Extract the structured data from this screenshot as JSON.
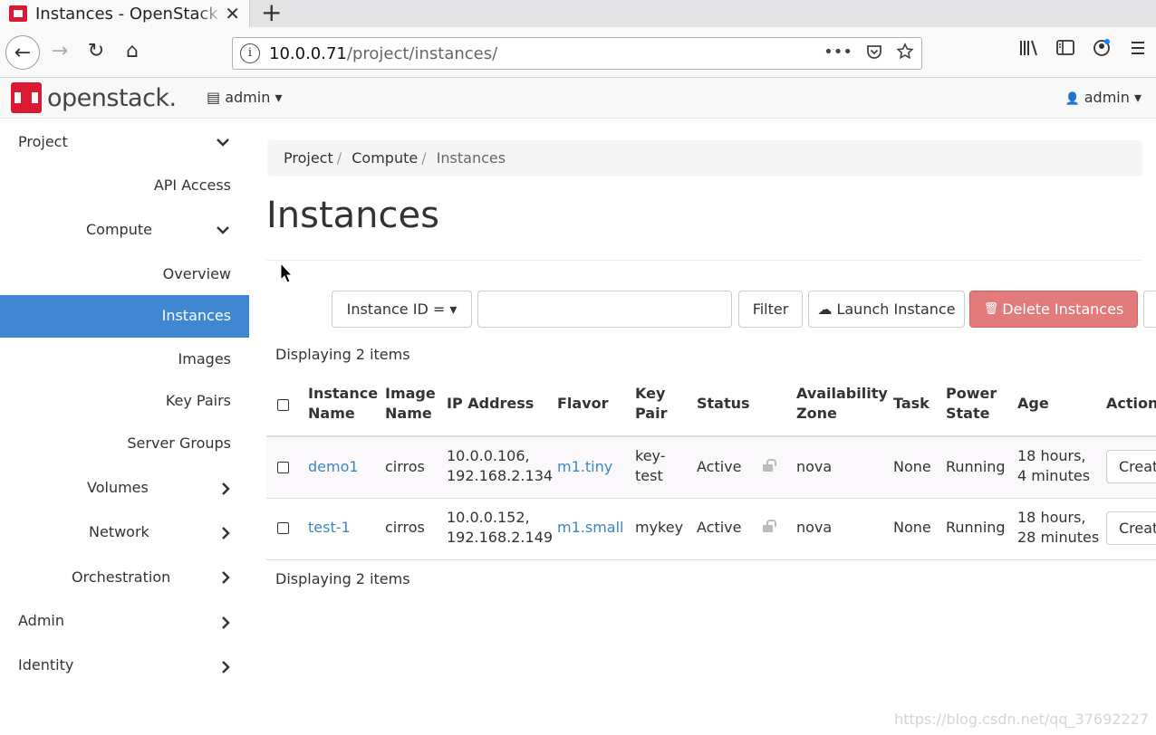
{
  "browser": {
    "tab_title": "Instances - OpenStack Dashboard",
    "close_glyph": "✕",
    "new_tab_glyph": "+",
    "url_host": "10.0.0.71",
    "url_path": "/project/instances/",
    "url_info_glyph": "i",
    "page_actions_glyph": "•••",
    "back_glyph": "←",
    "forward_glyph": "→",
    "reload_glyph": "↻",
    "home_glyph": "⌂"
  },
  "header": {
    "logo_text": "openstack.",
    "project_label": "admin",
    "user_label": "admin",
    "caret": "▾",
    "project_icon": "▤",
    "user_icon": "👤"
  },
  "sidebar": {
    "project": "Project",
    "api_access": "API Access",
    "compute": "Compute",
    "overview": "Overview",
    "instances": "Instances",
    "images": "Images",
    "key_pairs": "Key Pairs",
    "server_groups": "Server Groups",
    "volumes": "Volumes",
    "network": "Network",
    "orchestration": "Orchestration",
    "admin": "Admin",
    "identity": "Identity",
    "chevron_down": "⌄",
    "chevron_right": "›"
  },
  "breadcrumb": {
    "project": "Project",
    "compute": "Compute",
    "instances": "Instances",
    "sep": "/"
  },
  "page": {
    "title": "Instances",
    "count_top": "Displaying 2 items",
    "count_bottom": "Displaying 2 items"
  },
  "toolbar": {
    "filter_select": "Instance ID = ▾",
    "filter_value": "",
    "filter_button": "Filter",
    "launch_button": "Launch Instance",
    "launch_icon": "☁",
    "delete_button": "Delete Instances",
    "delete_icon": "🗑"
  },
  "table": {
    "headers": {
      "instance_name_1": "Instance",
      "instance_name_2": "Name",
      "image_name_1": "Image",
      "image_name_2": "Name",
      "ip_address": "IP Address",
      "flavor": "Flavor",
      "key_pair_1": "Key",
      "key_pair_2": "Pair",
      "status": "Status",
      "availability_zone_1": "Availability",
      "availability_zone_2": "Zone",
      "task": "Task",
      "power_state_1": "Power",
      "power_state_2": "State",
      "age": "Age",
      "actions": "Actions"
    },
    "rows": [
      {
        "name": "demo1",
        "image": "cirros",
        "ip_1": "10.0.0.106,",
        "ip_2": "192.168.2.134",
        "flavor": "m1.tiny",
        "key_1": "key-",
        "key_2": "test",
        "status": "Active",
        "zone": "nova",
        "task": "None",
        "power": "Running",
        "age_1": "18 hours,",
        "age_2": "4 minutes",
        "action": "Create"
      },
      {
        "name": "test-1",
        "image": "cirros",
        "ip_1": "10.0.0.152,",
        "ip_2": "192.168.2.149",
        "flavor": "m1.small",
        "key_1": "mykey",
        "key_2": "",
        "status": "Active",
        "zone": "nova",
        "task": "None",
        "power": "Running",
        "age_1": "18 hours,",
        "age_2": "28 minutes",
        "action": "Create"
      }
    ]
  },
  "watermark": "https://blog.csdn.net/qq_37692227",
  "colors": {
    "brand": "#da1a32",
    "active_nav": "#3f88d1",
    "link": "#3a87c8",
    "danger": "#e27b7b"
  }
}
